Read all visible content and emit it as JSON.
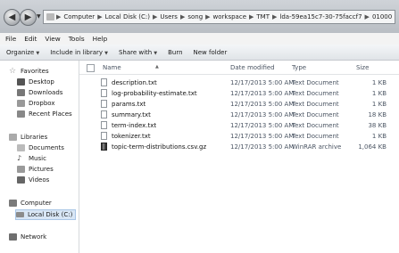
{
  "address": {
    "crumbs": [
      "Computer",
      "Local Disk (C:)",
      "Users",
      "song",
      "workspace",
      "TMT",
      "lda-59ea15c7-30-75faccf7",
      "01000"
    ],
    "separator": "▶"
  },
  "menu": [
    "File",
    "Edit",
    "View",
    "Tools",
    "Help"
  ],
  "toolbar": {
    "organize": "Organize",
    "include": "Include in library",
    "share": "Share with",
    "burn": "Burn",
    "new_folder": "New folder"
  },
  "nav": {
    "favorites": "Favorites",
    "desktop": "Desktop",
    "downloads": "Downloads",
    "dropbox": "Dropbox",
    "recent": "Recent Places",
    "libraries": "Libraries",
    "documents": "Documents",
    "music": "Music",
    "pictures": "Pictures",
    "videos": "Videos",
    "computer": "Computer",
    "localdisk": "Local Disk (C:)",
    "network": "Network"
  },
  "columns": {
    "name": "Name",
    "date": "Date modified",
    "type": "Type",
    "size": "Size"
  },
  "files": [
    {
      "name": "description.txt",
      "date": "12/17/2013 5:00 AM",
      "type": "Text Document",
      "size": "1 KB"
    },
    {
      "name": "log-probability-estimate.txt",
      "date": "12/17/2013 5:00 AM",
      "type": "Text Document",
      "size": "1 KB"
    },
    {
      "name": "params.txt",
      "date": "12/17/2013 5:00 AM",
      "type": "Text Document",
      "size": "1 KB"
    },
    {
      "name": "summary.txt",
      "date": "12/17/2013 5:00 AM",
      "type": "Text Document",
      "size": "18 KB"
    },
    {
      "name": "term-index.txt",
      "date": "12/17/2013 5:00 AM",
      "type": "Text Document",
      "size": "38 KB"
    },
    {
      "name": "tokenizer.txt",
      "date": "12/17/2013 5:00 AM",
      "type": "Text Document",
      "size": "1 KB"
    },
    {
      "name": "topic-term-distributions.csv.gz",
      "date": "12/17/2013 5:00 AM",
      "type": "WinRAR archive",
      "size": "1,064 KB"
    }
  ]
}
